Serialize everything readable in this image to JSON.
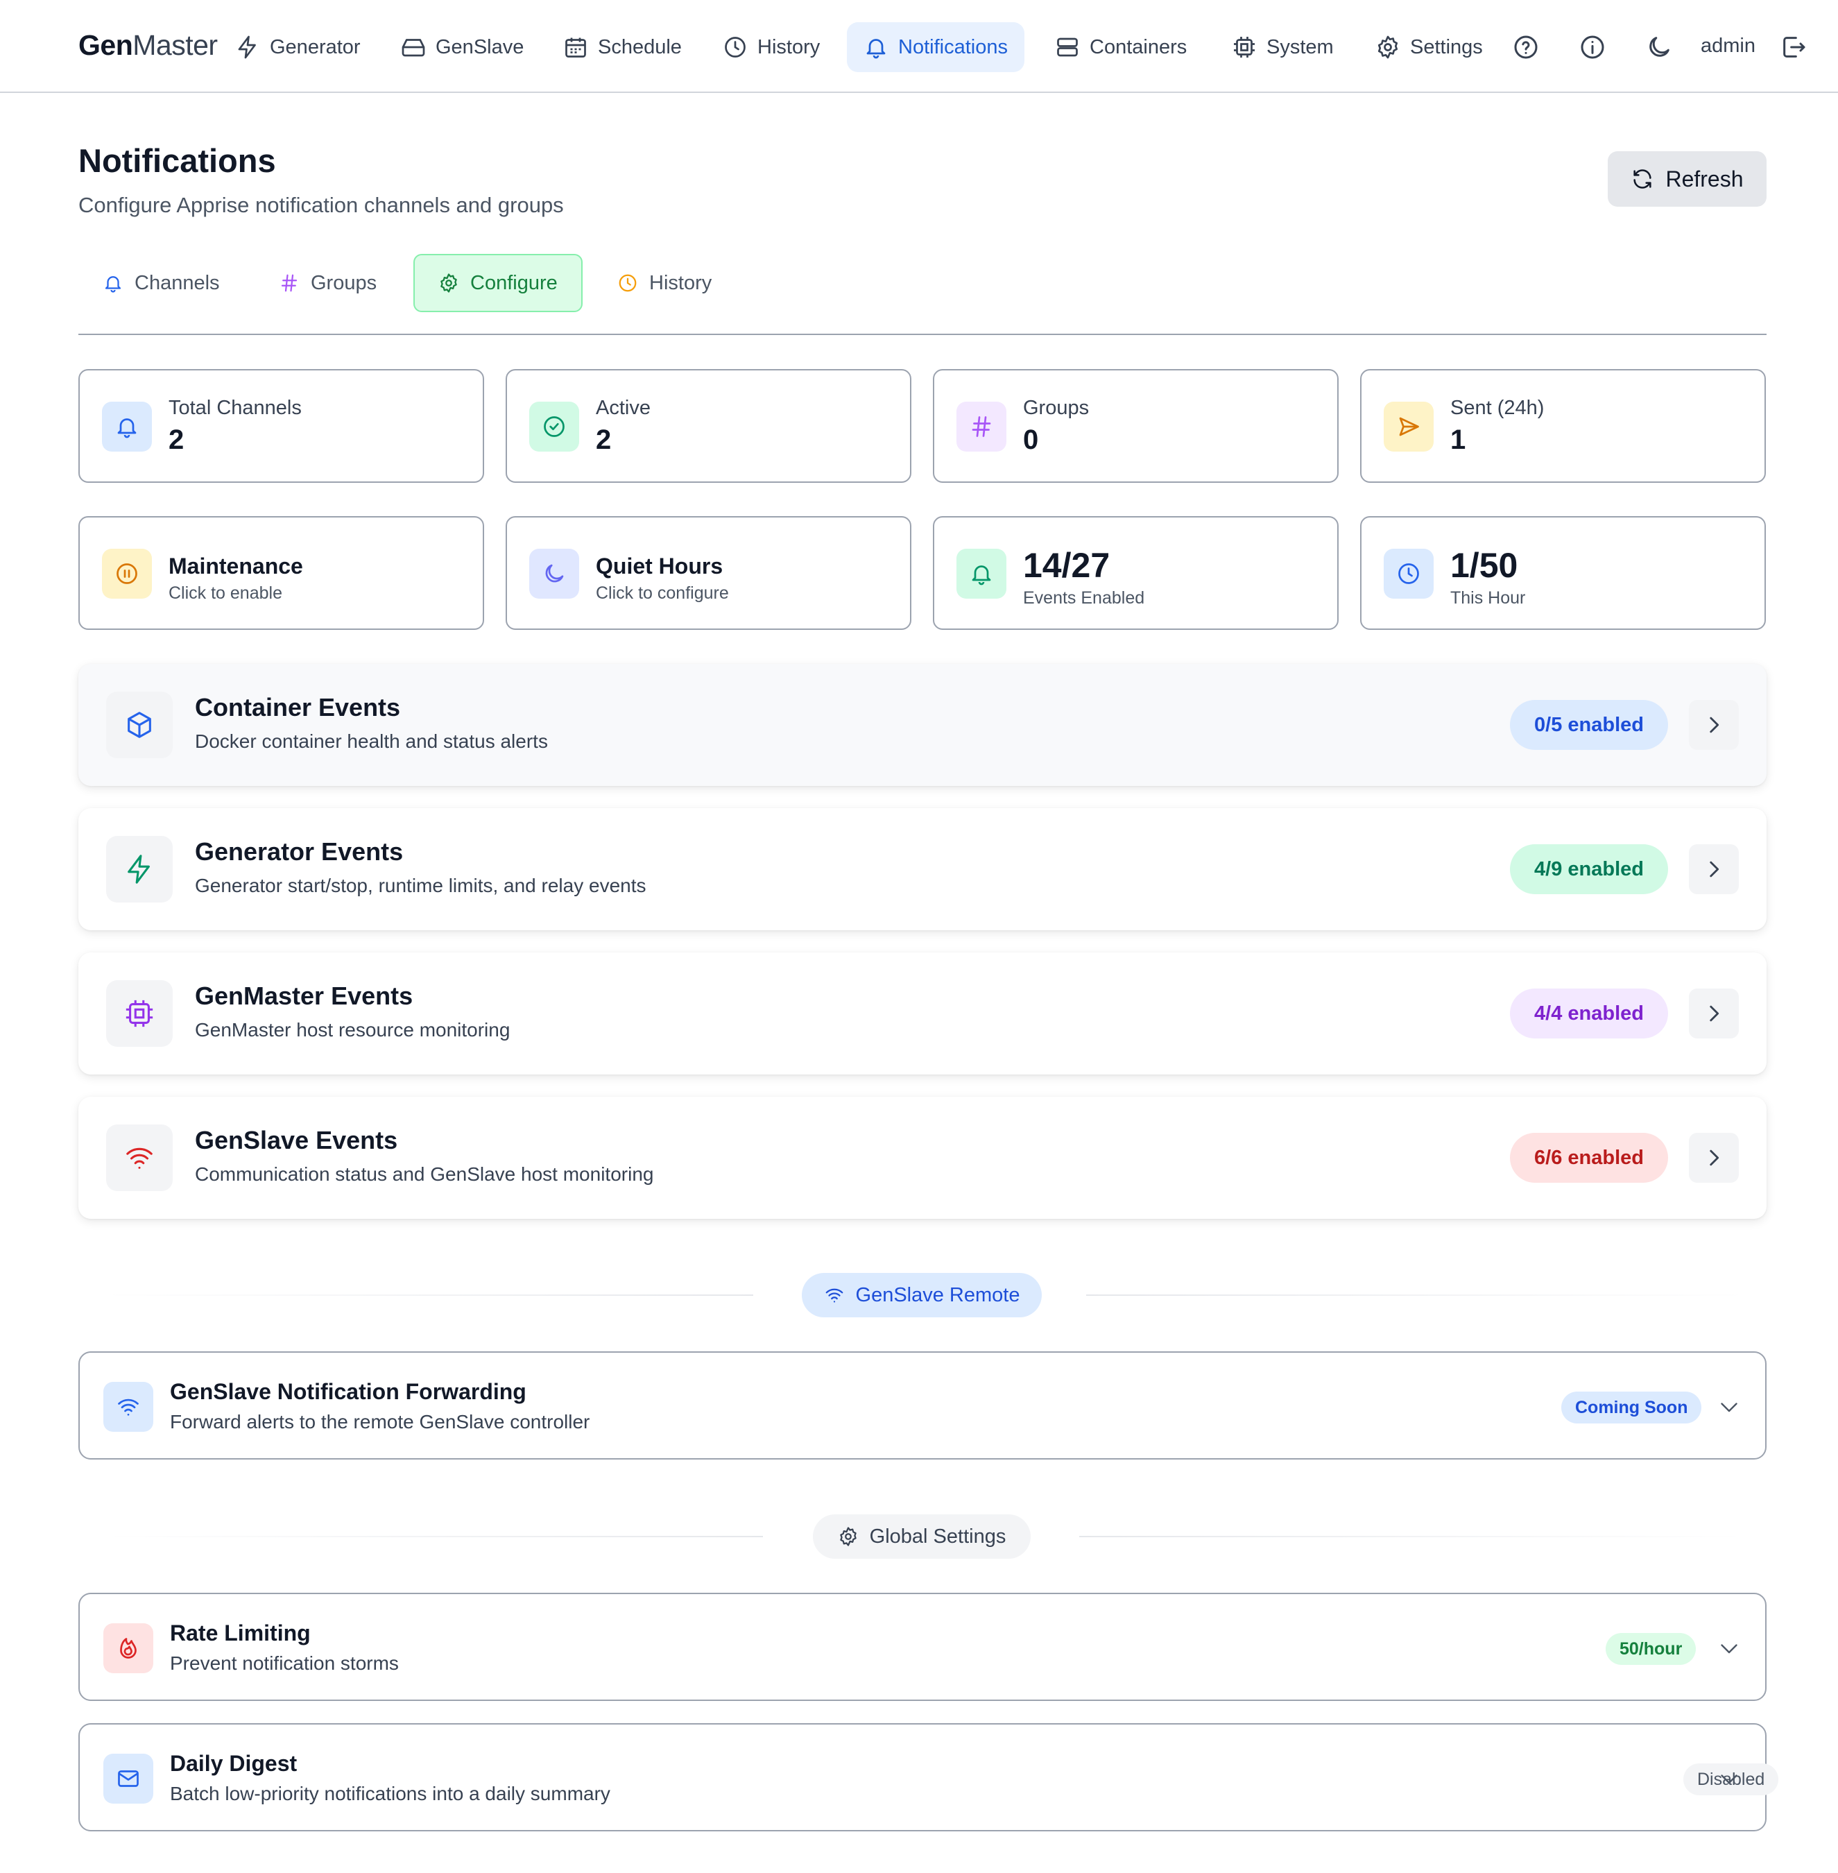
{
  "brand": {
    "part1": "Gen",
    "part2": "Master"
  },
  "nav": {
    "items": [
      {
        "label": "Generator",
        "icon": "bolt-icon"
      },
      {
        "label": "GenSlave",
        "icon": "hard-drive-icon"
      },
      {
        "label": "Schedule",
        "icon": "calendar-icon"
      },
      {
        "label": "History",
        "icon": "clock-icon"
      },
      {
        "label": "Notifications",
        "icon": "bell-icon",
        "active": true
      },
      {
        "label": "Containers",
        "icon": "server-icon"
      },
      {
        "label": "System",
        "icon": "cpu-icon"
      },
      {
        "label": "Settings",
        "icon": "gear-icon"
      }
    ],
    "user": "admin",
    "icons": [
      "help-icon",
      "info-icon",
      "moon-icon",
      "logout-icon"
    ]
  },
  "header": {
    "title": "Notifications",
    "subtitle": "Configure Apprise notification channels and groups",
    "refresh_label": "Refresh"
  },
  "tabs": [
    {
      "label": "Channels",
      "icon": "bell-icon"
    },
    {
      "label": "Groups",
      "icon": "hash-icon"
    },
    {
      "label": "Configure",
      "icon": "gear-icon",
      "active": true
    },
    {
      "label": "History",
      "icon": "clock-icon"
    }
  ],
  "stats": {
    "total_channels": {
      "label": "Total Channels",
      "value": "2"
    },
    "active": {
      "label": "Active",
      "value": "2"
    },
    "groups": {
      "label": "Groups",
      "value": "0"
    },
    "sent": {
      "label": "Sent (24h)",
      "value": "1"
    },
    "maintenance": {
      "title": "Maintenance",
      "subtitle": "Click to enable"
    },
    "quiet_hours": {
      "title": "Quiet Hours",
      "subtitle": "Click to configure"
    },
    "events_enabled": {
      "value": "14/27",
      "label": "Events Enabled"
    },
    "this_hour": {
      "value": "1/50",
      "label": "This Hour"
    }
  },
  "categories": [
    {
      "title": "Container Events",
      "description": "Docker container health and status alerts",
      "status": "0/5 enabled",
      "color": "#2563eb"
    },
    {
      "title": "Generator Events",
      "description": "Generator start/stop, runtime limits, and relay events",
      "status": "4/9 enabled",
      "color": "#059669"
    },
    {
      "title": "GenMaster Events",
      "description": "GenMaster host resource monitoring",
      "status": "4/4 enabled",
      "color": "#7e22ce"
    },
    {
      "title": "GenSlave Events",
      "description": "Communication status and GenSlave host monitoring",
      "status": "6/6 enabled",
      "color": "#dc2626"
    }
  ],
  "sections": {
    "remote": {
      "label": "GenSlave Remote"
    },
    "global": {
      "label": "Global Settings"
    }
  },
  "forwarding": {
    "title": "GenSlave Notification Forwarding",
    "description": "Forward alerts to the remote GenSlave controller",
    "badge": "Coming Soon"
  },
  "rate_limiting": {
    "title": "Rate Limiting",
    "description": "Prevent notification storms",
    "badge": "50/hour"
  },
  "daily_digest": {
    "title": "Daily Digest",
    "description": "Batch low-priority notifications into a daily summary",
    "badge": "Disabled"
  }
}
